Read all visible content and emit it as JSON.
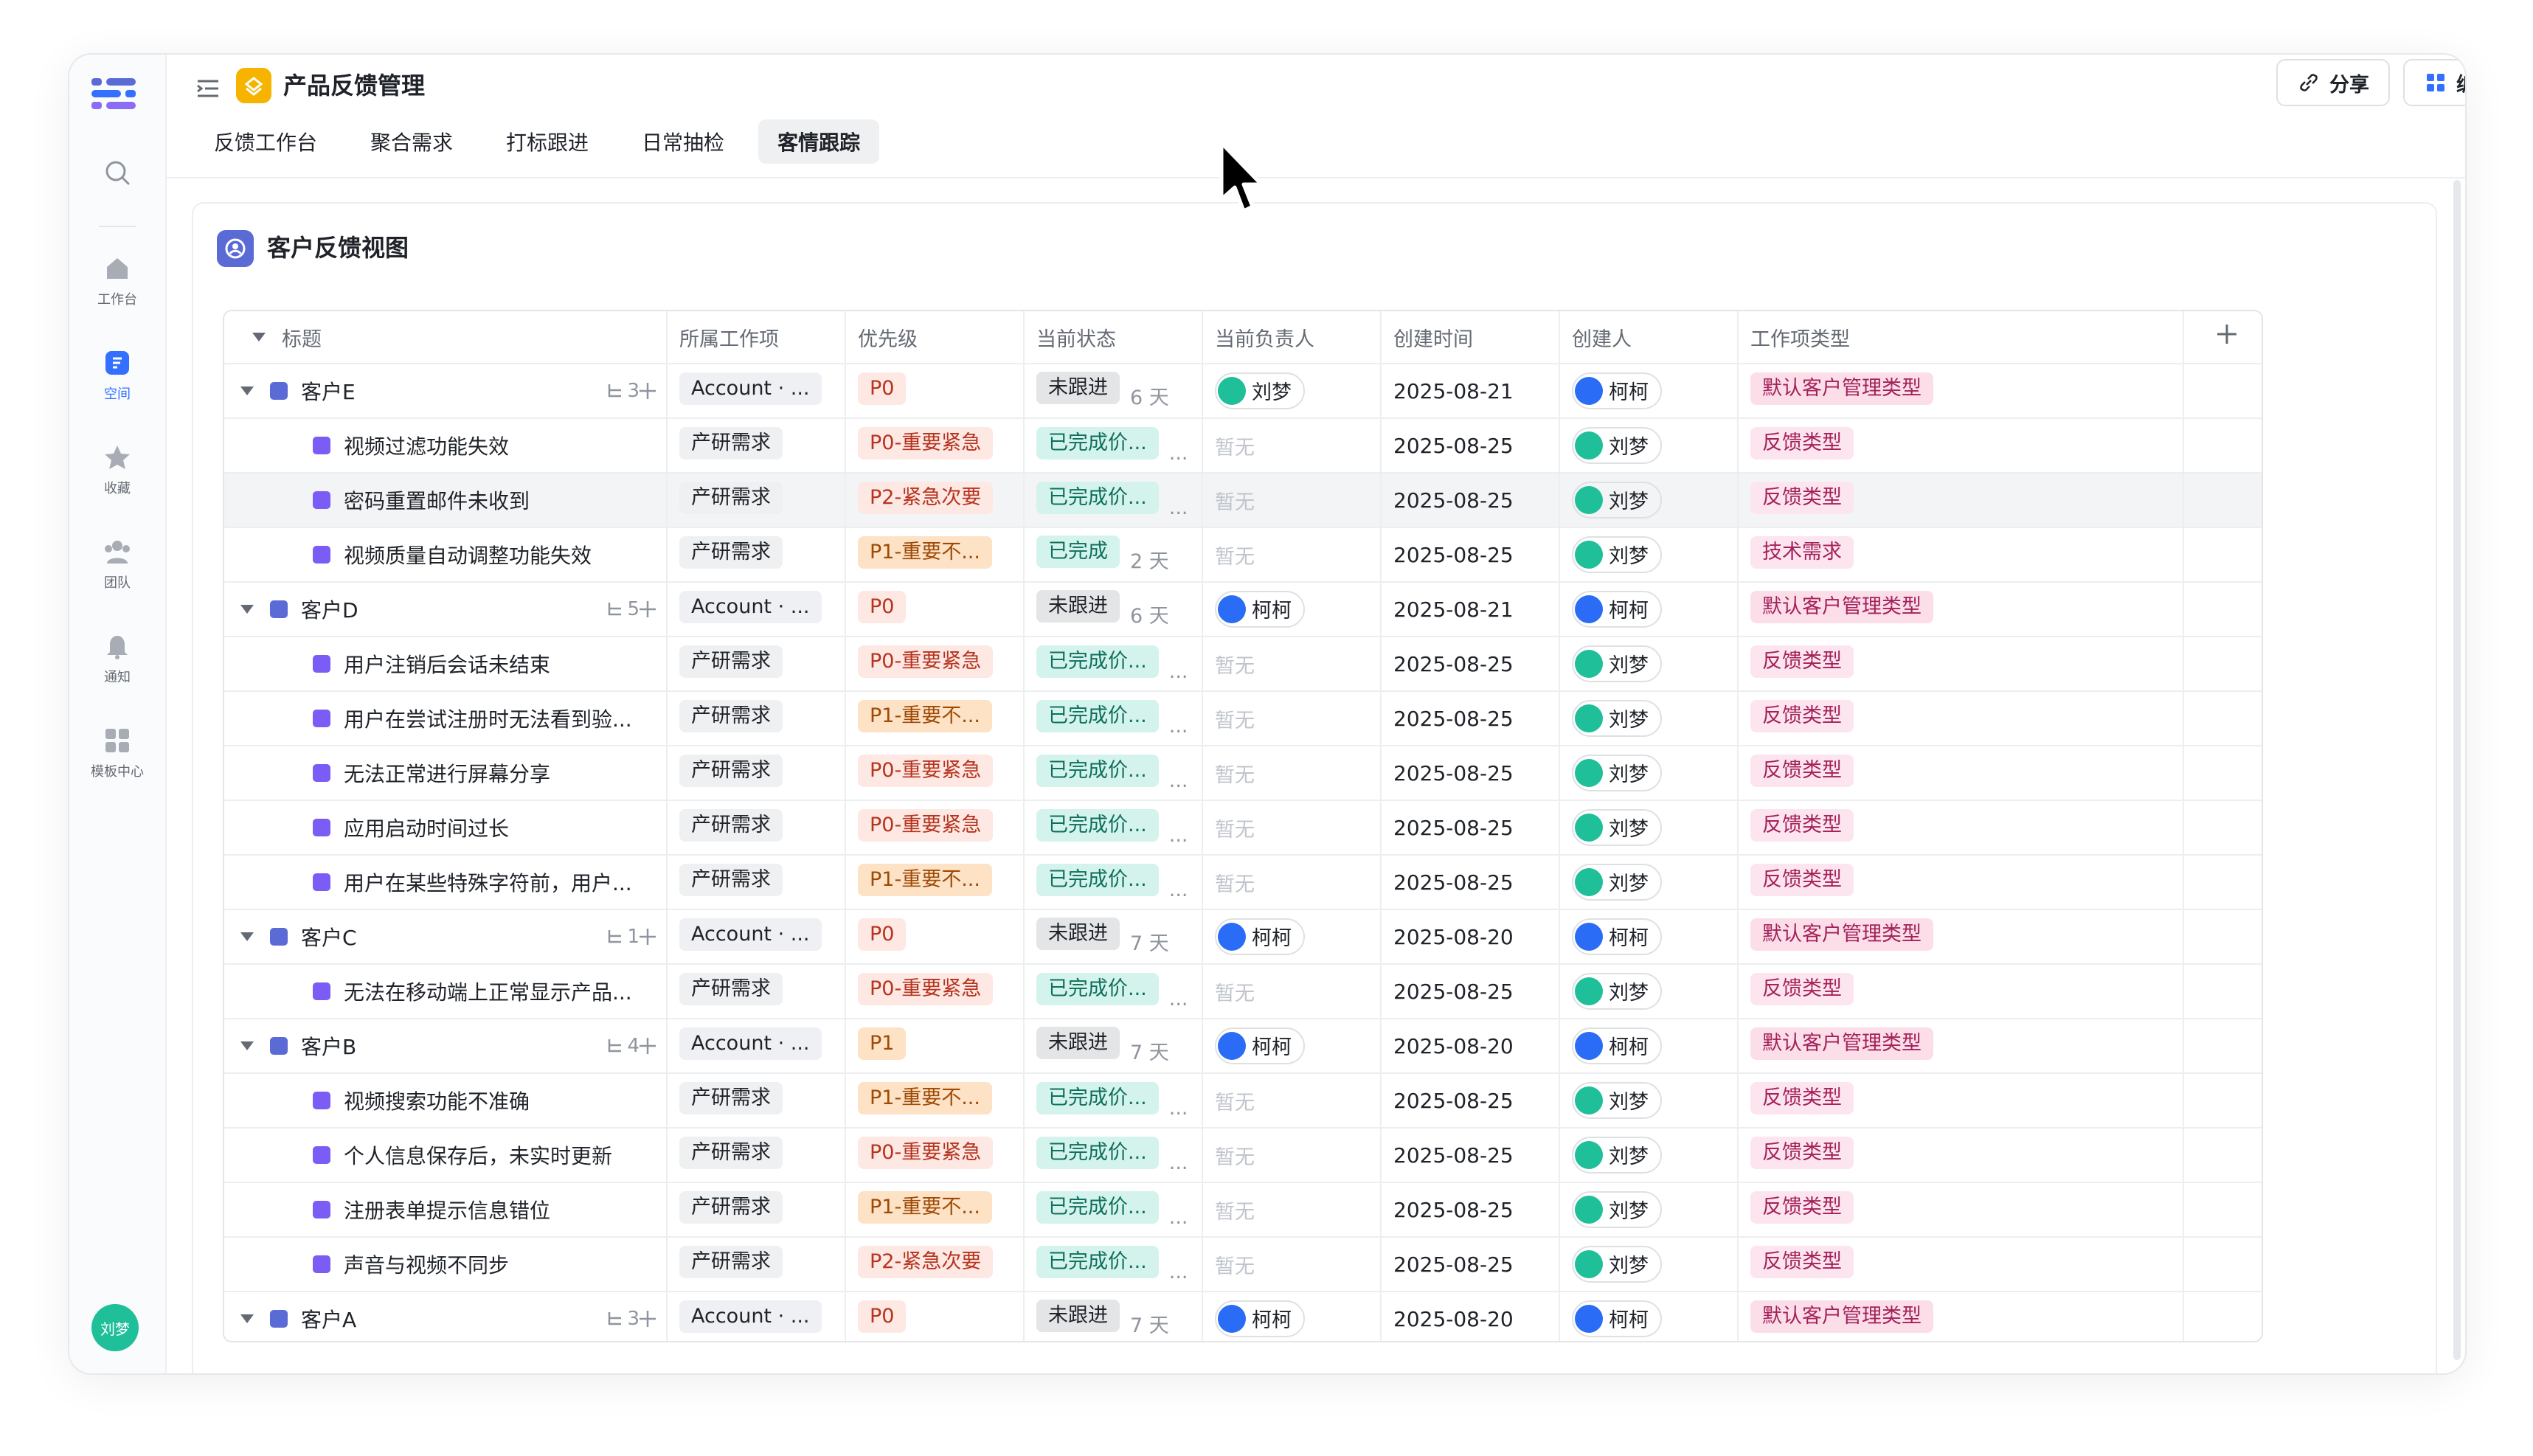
{
  "sidebar": {
    "items": [
      {
        "label": "",
        "icon": "search-icon"
      },
      {
        "label": "工作台",
        "icon": "home-icon"
      },
      {
        "label": "空间",
        "icon": "space-icon",
        "active": true
      },
      {
        "label": "收藏",
        "icon": "star-icon"
      },
      {
        "label": "团队",
        "icon": "team-icon"
      },
      {
        "label": "通知",
        "icon": "bell-icon"
      },
      {
        "label": "模板中心",
        "icon": "template-icon"
      }
    ],
    "user_avatar": "刘梦"
  },
  "header": {
    "title": "产品反馈管理",
    "tabs": [
      "反馈工作台",
      "聚合需求",
      "打标跟进",
      "日常抽检",
      "客情跟踪"
    ],
    "active_tab": "客情跟踪",
    "share_label": "分享",
    "edit_label": "编辑"
  },
  "view": {
    "title": "客户反馈视图",
    "columns": [
      "标题",
      "所属工作项",
      "优先级",
      "当前状态",
      "当前负责人",
      "创建时间",
      "创建人",
      "工作项类型"
    ],
    "rows": [
      {
        "level": 0,
        "title": "客户E",
        "sub_count": "3",
        "item": "Account · ...",
        "priority": "P0",
        "status": "未跟进",
        "days": "6 天",
        "owner": "刘梦",
        "owner_color": "g",
        "created": "2025-08-21",
        "creator": "柯柯",
        "creator_color": "b",
        "type": "默认客户管理类型"
      },
      {
        "level": 1,
        "title": "视频过滤功能失效",
        "item": "产研需求",
        "priority": "P0-重要紧急",
        "status": "已完成价...",
        "days": "...",
        "owner": "暂无",
        "created": "2025-08-25",
        "creator": "刘梦",
        "creator_color": "g",
        "type": "反馈类型"
      },
      {
        "level": 1,
        "title": "密码重置邮件未收到",
        "item": "产研需求",
        "priority": "P2-紧急次要",
        "status": "已完成价...",
        "days": "...",
        "owner": "暂无",
        "created": "2025-08-25",
        "creator": "刘梦",
        "creator_color": "g",
        "type": "反馈类型",
        "highlight": true
      },
      {
        "level": 1,
        "title": "视频质量自动调整功能失效",
        "item": "产研需求",
        "priority": "P1-重要不...",
        "status": "已完成",
        "days": "2 天",
        "owner": "暂无",
        "created": "2025-08-25",
        "creator": "刘梦",
        "creator_color": "g",
        "type": "技术需求"
      },
      {
        "level": 0,
        "title": "客户D",
        "sub_count": "5",
        "item": "Account · ...",
        "priority": "P0",
        "status": "未跟进",
        "days": "6 天",
        "owner": "柯柯",
        "owner_color": "b",
        "created": "2025-08-21",
        "creator": "柯柯",
        "creator_color": "b",
        "type": "默认客户管理类型"
      },
      {
        "level": 1,
        "title": "用户注销后会话未结束",
        "item": "产研需求",
        "priority": "P0-重要紧急",
        "status": "已完成价...",
        "days": "...",
        "owner": "暂无",
        "created": "2025-08-25",
        "creator": "刘梦",
        "creator_color": "g",
        "type": "反馈类型"
      },
      {
        "level": 1,
        "title": "用户在尝试注册时无法看到验...",
        "item": "产研需求",
        "priority": "P1-重要不...",
        "status": "已完成价...",
        "days": "...",
        "owner": "暂无",
        "created": "2025-08-25",
        "creator": "刘梦",
        "creator_color": "g",
        "type": "反馈类型"
      },
      {
        "level": 1,
        "title": "无法正常进行屏幕分享",
        "item": "产研需求",
        "priority": "P0-重要紧急",
        "status": "已完成价...",
        "days": "...",
        "owner": "暂无",
        "created": "2025-08-25",
        "creator": "刘梦",
        "creator_color": "g",
        "type": "反馈类型"
      },
      {
        "level": 1,
        "title": "应用启动时间过长",
        "item": "产研需求",
        "priority": "P0-重要紧急",
        "status": "已完成价...",
        "days": "...",
        "owner": "暂无",
        "created": "2025-08-25",
        "creator": "刘梦",
        "creator_color": "g",
        "type": "反馈类型"
      },
      {
        "level": 1,
        "title": "用户在某些特殊字符前，用户...",
        "item": "产研需求",
        "priority": "P1-重要不...",
        "status": "已完成价...",
        "days": "...",
        "owner": "暂无",
        "created": "2025-08-25",
        "creator": "刘梦",
        "creator_color": "g",
        "type": "反馈类型"
      },
      {
        "level": 0,
        "title": "客户C",
        "sub_count": "1",
        "item": "Account · ...",
        "priority": "P0",
        "status": "未跟进",
        "days": "7 天",
        "owner": "柯柯",
        "owner_color": "b",
        "created": "2025-08-20",
        "creator": "柯柯",
        "creator_color": "b",
        "type": "默认客户管理类型"
      },
      {
        "level": 1,
        "title": "无法在移动端上正常显示产品...",
        "item": "产研需求",
        "priority": "P0-重要紧急",
        "status": "已完成价...",
        "days": "...",
        "owner": "暂无",
        "created": "2025-08-25",
        "creator": "刘梦",
        "creator_color": "g",
        "type": "反馈类型"
      },
      {
        "level": 0,
        "title": "客户B",
        "sub_count": "4",
        "item": "Account · ...",
        "priority": "P1",
        "status": "未跟进",
        "days": "7 天",
        "owner": "柯柯",
        "owner_color": "b",
        "created": "2025-08-20",
        "creator": "柯柯",
        "creator_color": "b",
        "type": "默认客户管理类型"
      },
      {
        "level": 1,
        "title": "视频搜索功能不准确",
        "item": "产研需求",
        "priority": "P1-重要不...",
        "status": "已完成价...",
        "days": "...",
        "owner": "暂无",
        "created": "2025-08-25",
        "creator": "刘梦",
        "creator_color": "g",
        "type": "反馈类型"
      },
      {
        "level": 1,
        "title": "个人信息保存后，未实时更新",
        "item": "产研需求",
        "priority": "P0-重要紧急",
        "status": "已完成价...",
        "days": "...",
        "owner": "暂无",
        "created": "2025-08-25",
        "creator": "刘梦",
        "creator_color": "g",
        "type": "反馈类型"
      },
      {
        "level": 1,
        "title": "注册表单提示信息错位",
        "item": "产研需求",
        "priority": "P1-重要不...",
        "status": "已完成价...",
        "days": "...",
        "owner": "暂无",
        "created": "2025-08-25",
        "creator": "刘梦",
        "creator_color": "g",
        "type": "反馈类型"
      },
      {
        "level": 1,
        "title": "声音与视频不同步",
        "item": "产研需求",
        "priority": "P2-紧急次要",
        "status": "已完成价...",
        "days": "...",
        "owner": "暂无",
        "created": "2025-08-25",
        "creator": "刘梦",
        "creator_color": "g",
        "type": "反馈类型"
      },
      {
        "level": 0,
        "title": "客户A",
        "sub_count": "3",
        "item": "Account · ...",
        "priority": "P0",
        "status": "未跟进",
        "days": "7 天",
        "owner": "柯柯",
        "owner_color": "b",
        "created": "2025-08-20",
        "creator": "柯柯",
        "creator_color": "b",
        "type": "默认客户管理类型"
      }
    ]
  },
  "colors": {
    "accent": "#3370ff",
    "app_icon": "#f6b400",
    "customer_square": "#5b6bd6",
    "item_square": "#7b5cf5"
  }
}
